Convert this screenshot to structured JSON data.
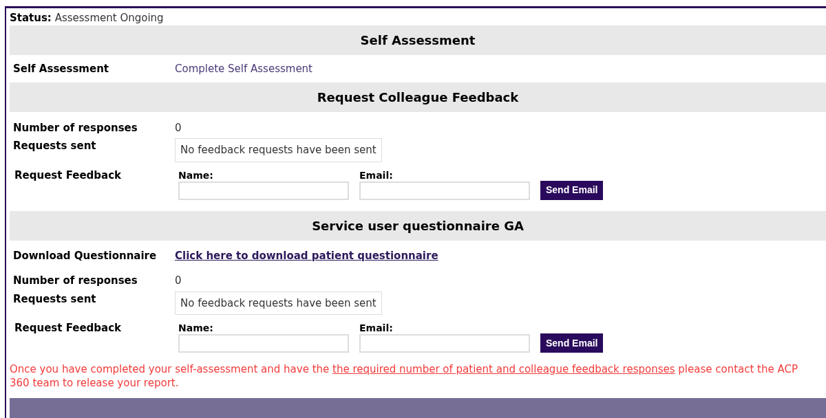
{
  "status": {
    "label": "Status:",
    "value": "Assessment Ongoing"
  },
  "sections": [
    {
      "title": "Self Assessment",
      "rows": [
        {
          "kind": "action",
          "label": "Self Assessment",
          "value": "Complete Self Assessment"
        }
      ]
    },
    {
      "title": "Request Colleague Feedback",
      "rows": [
        {
          "kind": "text",
          "label": "Number of responses",
          "value": "0"
        },
        {
          "kind": "box",
          "label": "Requests sent",
          "value": "No feedback requests have been sent"
        },
        {
          "kind": "form",
          "label": "Request Feedback",
          "name_label": "Name:",
          "email_label": "Email:",
          "button": "Send Email"
        }
      ]
    },
    {
      "title": "Service user questionnaire GA",
      "rows": [
        {
          "kind": "link",
          "label": "Download Questionnaire",
          "value": "Click here to download patient questionnaire"
        },
        {
          "kind": "text",
          "label": "Number of responses",
          "value": "0"
        },
        {
          "kind": "box",
          "label": "Requests sent",
          "value": "No feedback requests have been sent"
        },
        {
          "kind": "form",
          "label": "Request Feedback",
          "name_label": "Name:",
          "email_label": "Email:",
          "button": "Send Email"
        }
      ]
    }
  ],
  "note": {
    "before": "Once you have completed your self-assessment and have the ",
    "link": "the required number of patient and colleague feedback responses",
    "after": " please contact the ACP 360 team to release your report."
  }
}
